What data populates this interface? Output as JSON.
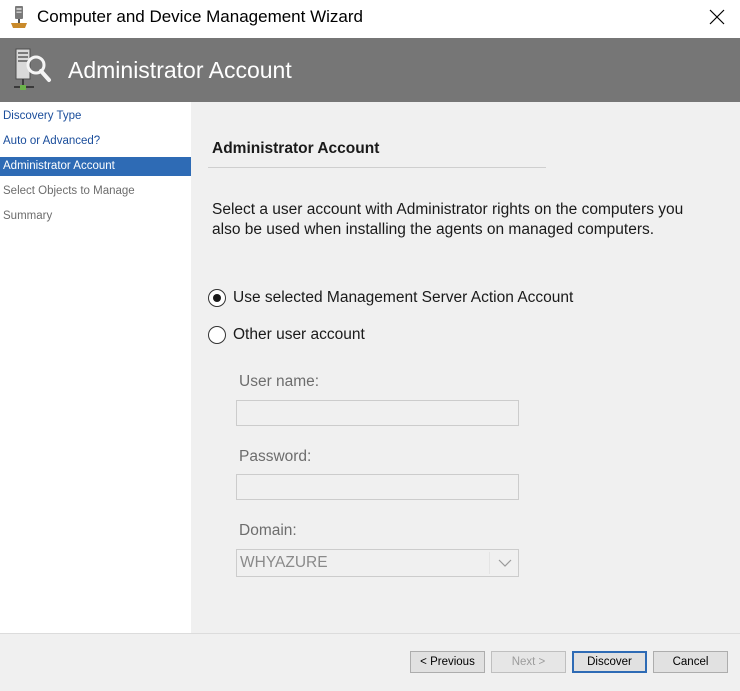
{
  "window": {
    "title": "Computer and Device Management Wizard",
    "icon": "wizard-computer-icon",
    "close_icon": "close-icon"
  },
  "header": {
    "title": "Administrator Account",
    "icon": "server-search-icon"
  },
  "sidebar": {
    "items": [
      {
        "label": "Discovery Type",
        "state": "link"
      },
      {
        "label": "Auto or Advanced?",
        "state": "link"
      },
      {
        "label": "Administrator Account",
        "state": "active"
      },
      {
        "label": "Select Objects to Manage",
        "state": "disabled"
      },
      {
        "label": "Summary",
        "state": "disabled"
      }
    ]
  },
  "main": {
    "section_title": "Administrator Account",
    "description_line1": "Select a user account with Administrator rights on the computers you",
    "description_line2": "also be used when installing the agents on managed computers.",
    "options": [
      {
        "label": "Use selected Management Server Action Account",
        "checked": true
      },
      {
        "label": "Other user account",
        "checked": false
      }
    ],
    "username": {
      "label": "User name:",
      "value": ""
    },
    "password": {
      "label": "Password:",
      "value": ""
    },
    "domain": {
      "label": "Domain:",
      "value": "WHYAZURE"
    }
  },
  "footer": {
    "previous_label": "< Previous",
    "next_label": "Next >",
    "discover_label": "Discover",
    "cancel_label": "Cancel"
  },
  "colors": {
    "header_bg": "#767676",
    "accent": "#2e6bb5",
    "link": "#1a4d9b",
    "pane_bg": "#f0f0f0"
  }
}
